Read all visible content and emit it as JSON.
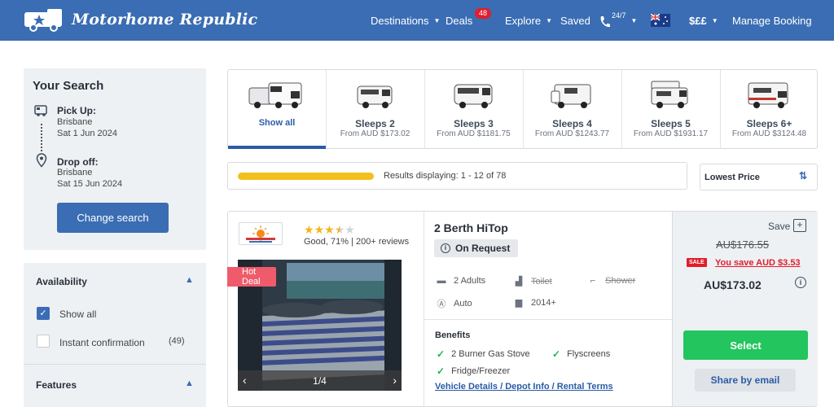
{
  "header": {
    "logo_text": "Motorhome Republic",
    "nav": {
      "destinations": "Destinations",
      "deals": "Deals",
      "deals_badge": "48",
      "explore": "Explore",
      "saved": "Saved",
      "support": "24/7",
      "currency": "$££",
      "manage_booking": "Manage Booking"
    }
  },
  "search": {
    "title": "Your Search",
    "pickup_label": "Pick Up:",
    "pickup_location": "Brisbane",
    "pickup_date": "Sat 1 Jun 2024",
    "dropoff_label": "Drop off:",
    "dropoff_location": "Brisbane",
    "dropoff_date": "Sat 15 Jun 2024",
    "change_button": "Change search"
  },
  "filters": {
    "availability": {
      "heading": "Availability",
      "show_all": "Show all",
      "show_all_checked": true,
      "instant_confirmation": "Instant confirmation",
      "instant_confirmation_count": "(49)"
    },
    "features": {
      "heading": "Features"
    }
  },
  "categories": [
    {
      "name": "Show all",
      "price": "",
      "active": true
    },
    {
      "name": "Sleeps 2",
      "price": "From AUD $173.02"
    },
    {
      "name": "Sleeps 3",
      "price": "From AUD $1181.75"
    },
    {
      "name": "Sleeps 4",
      "price": "From AUD $1243.77"
    },
    {
      "name": "Sleeps 5",
      "price": "From AUD $1931.17"
    },
    {
      "name": "Sleeps 6+",
      "price": "From AUD $3124.48"
    }
  ],
  "results": {
    "progress_fraction": 1.0,
    "text": "Results displaying: 1 - 12 of 78",
    "sort_label": "Lowest Price"
  },
  "listing": {
    "rating_stars": 3.5,
    "rating_text": "Good, 71% | 200+ reviews",
    "hot_deal": "Hot Deal",
    "photo_counter": "1/4",
    "title": "2 Berth HiTop",
    "availability": "On Request",
    "features": {
      "adults": "2 Adults",
      "toilet": "Toilet",
      "shower": "Shower",
      "transmission": "Auto",
      "year": "2014+"
    },
    "benefits_title": "Benefits",
    "benefits": [
      "2 Burner Gas Stove",
      "Flyscreens",
      "Fridge/Freezer"
    ],
    "details_link": "Vehicle Details / Depot Info / Rental Terms",
    "save_label": "Save",
    "old_price": "AU$176.55",
    "sale_tag": "SALE",
    "you_save": "You save AUD $3.53",
    "price": "AU$173.02",
    "select_button": "Select",
    "share_button": "Share by email"
  },
  "colors": {
    "brand_blue": "#3a6db3",
    "select_green": "#22c55e",
    "sale_red": "#e21d2b",
    "progress_yellow": "#f2c01d"
  }
}
